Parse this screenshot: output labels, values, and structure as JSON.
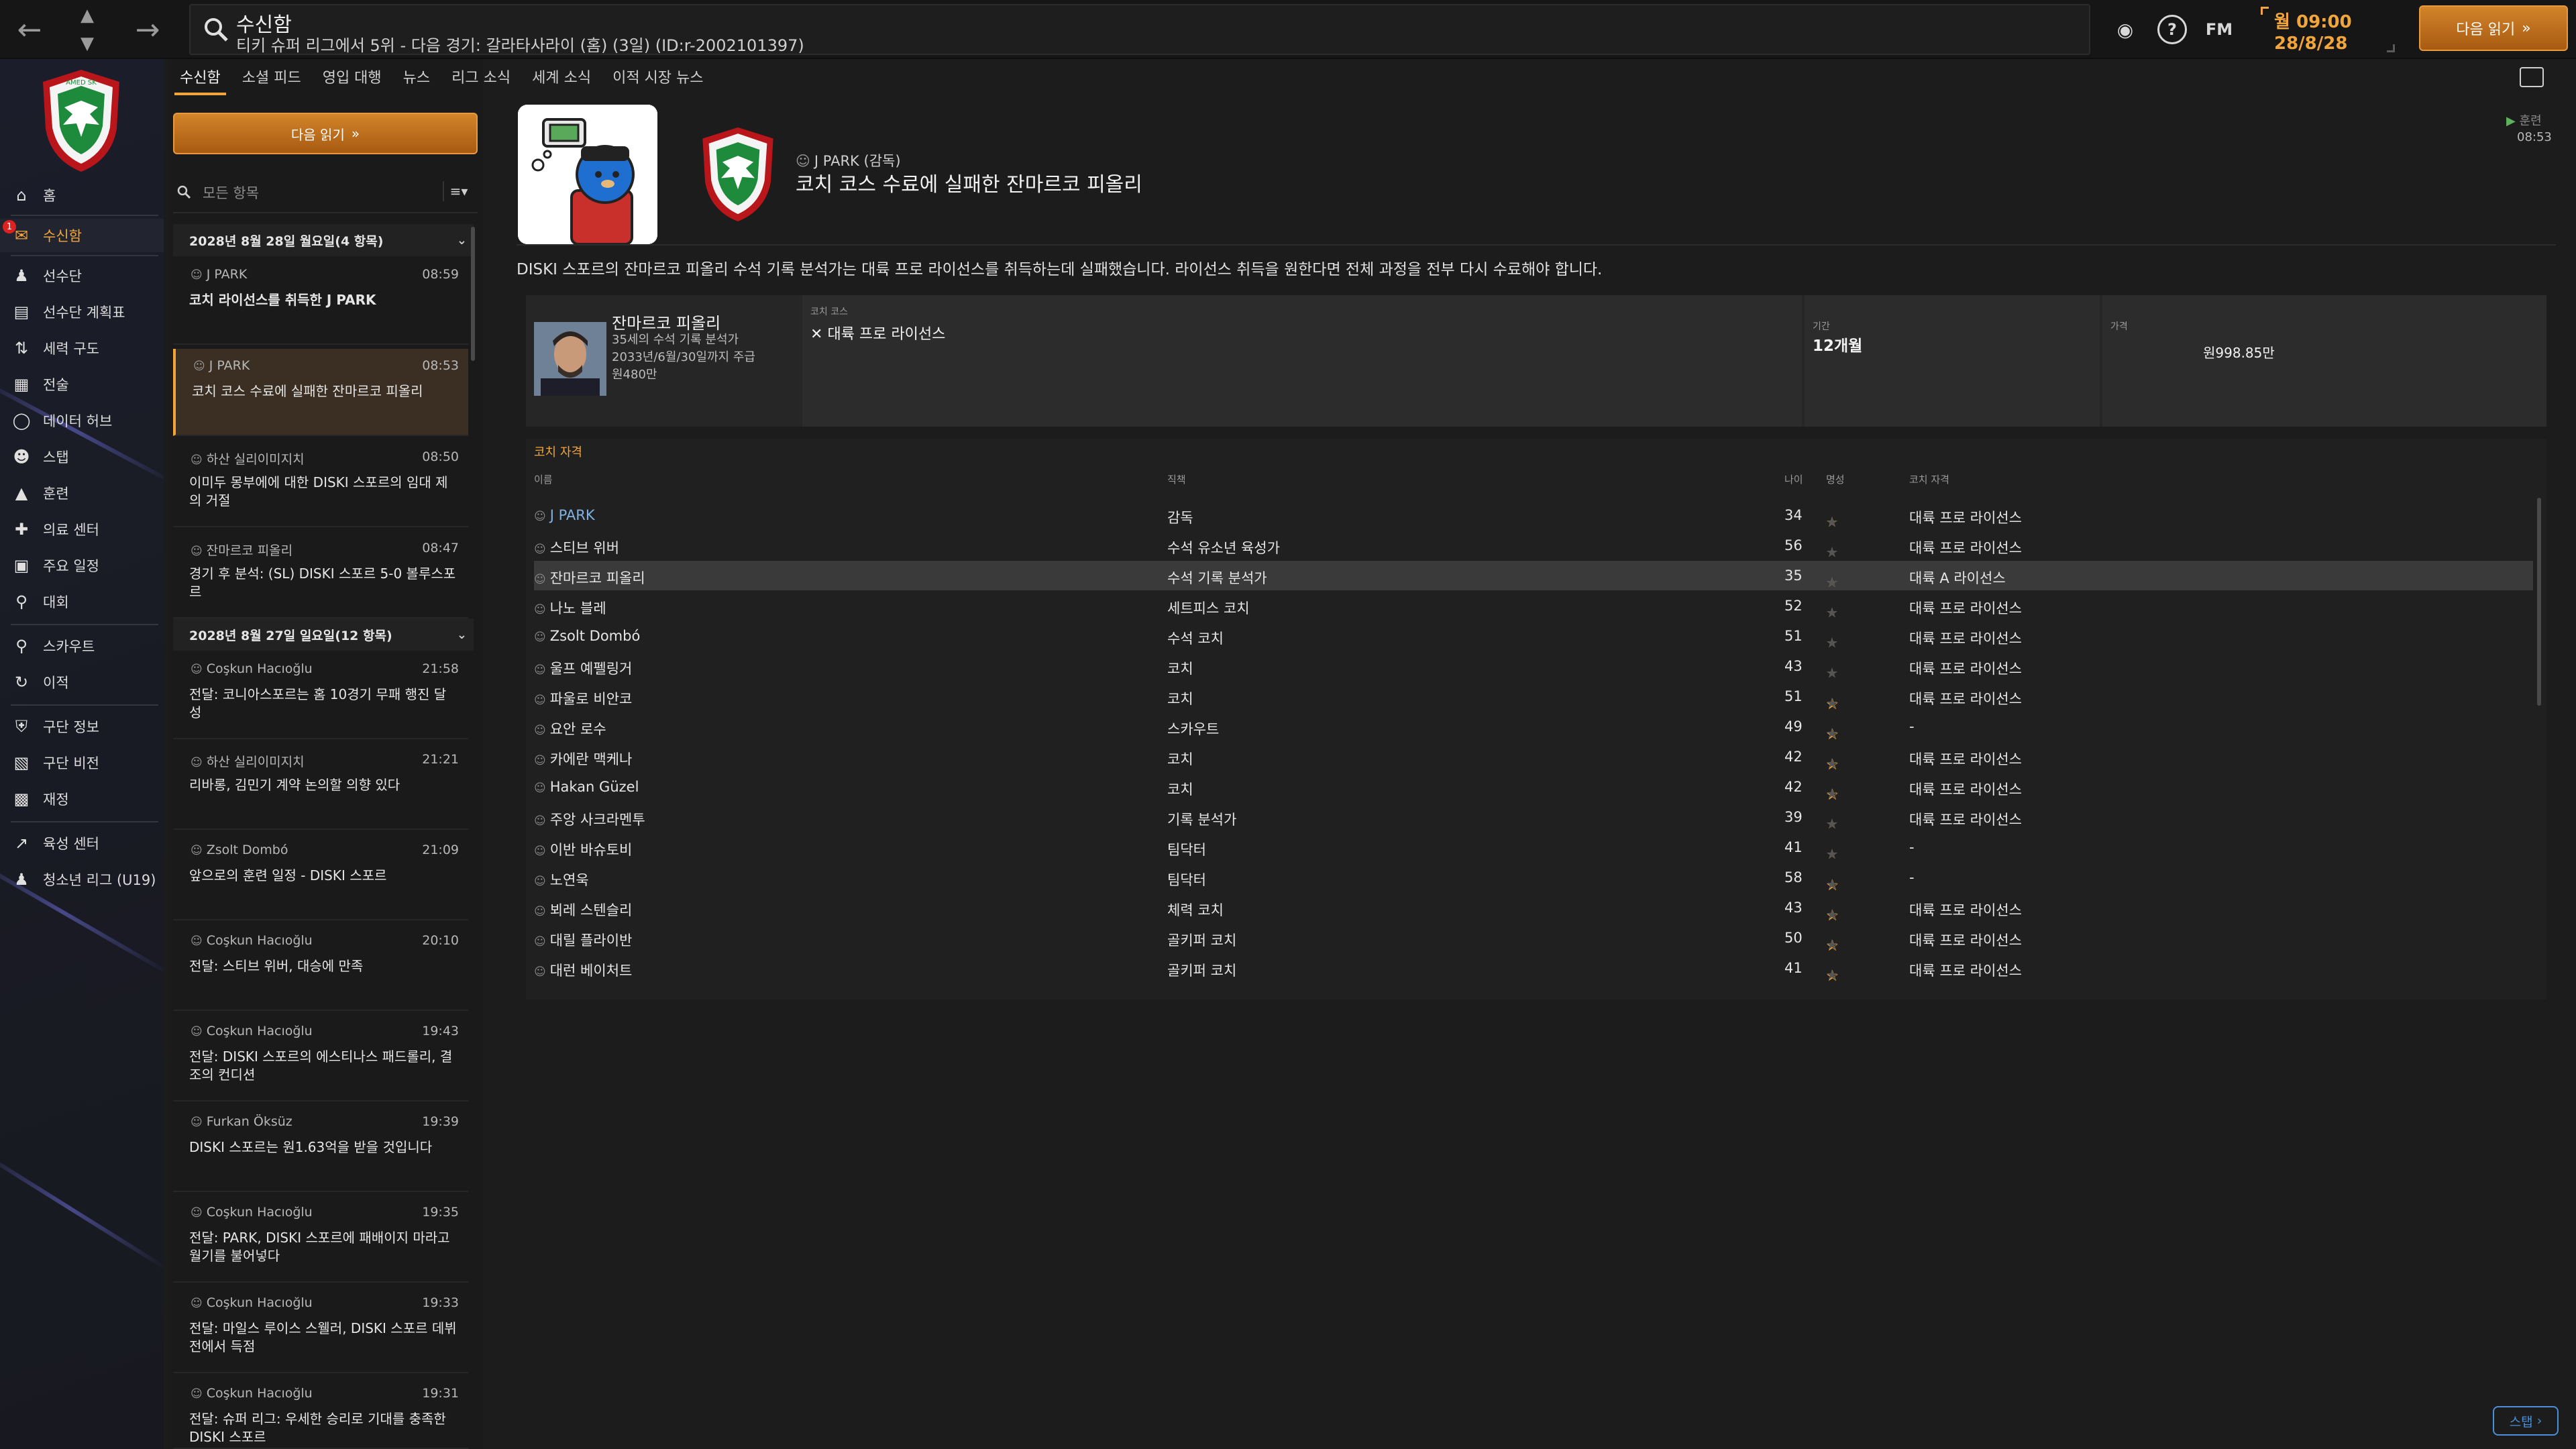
{
  "header": {
    "title": "수신함",
    "subtitle": "티키 슈퍼 리그에서 5위 - 다음 경기: 갈라타사라이 (홈) (3일) (ID:r-2002101397)",
    "fm_label": "FM",
    "day_time": "월 09:00",
    "date": "28/8/28",
    "continue_label": "다음 읽기"
  },
  "sidebar": {
    "badge": "1",
    "items": [
      {
        "label": "홈",
        "icon": "home-icon"
      },
      {
        "label": "수신함",
        "icon": "inbox-icon"
      },
      {
        "label": "선수단",
        "icon": "squad-icon"
      },
      {
        "label": "선수단 계획표",
        "icon": "plan-icon"
      },
      {
        "label": "세력 구도",
        "icon": "dynamics-icon"
      },
      {
        "label": "전술",
        "icon": "tactics-icon"
      },
      {
        "label": "데이터 허브",
        "icon": "data-hub-icon"
      },
      {
        "label": "스탭",
        "icon": "staff-icon"
      },
      {
        "label": "훈련",
        "icon": "training-icon"
      },
      {
        "label": "의료 센터",
        "icon": "medical-icon"
      },
      {
        "label": "주요 일정",
        "icon": "calendar-icon"
      },
      {
        "label": "대회",
        "icon": "trophy-icon"
      },
      {
        "label": "스카우트",
        "icon": "scout-icon"
      },
      {
        "label": "이적",
        "icon": "transfer-icon"
      },
      {
        "label": "구단 정보",
        "icon": "club-info-icon"
      },
      {
        "label": "구단 비전",
        "icon": "club-vision-icon"
      },
      {
        "label": "재정",
        "icon": "finance-icon"
      },
      {
        "label": "육성 센터",
        "icon": "development-icon"
      },
      {
        "label": "청소년 리그 (U19)",
        "icon": "youth-icon"
      }
    ]
  },
  "tabs": [
    "수신함",
    "소셜 피드",
    "영입 대행",
    "뉴스",
    "리그 소식",
    "세계 소식",
    "이적 시장 뉴스"
  ],
  "left": {
    "read_button": "다음 읽기",
    "filter_placeholder": "모든 항목",
    "groups": [
      {
        "label": "2028년 8월 28일 월요일(4 항목)"
      },
      {
        "label": "2028년 8월 27일 일요일(12 항목)"
      }
    ],
    "messages": [
      {
        "sender": "J PARK",
        "time": "08:59",
        "subject": "코치 라이선스를 취득한 J PARK"
      },
      {
        "sender": "J PARK",
        "time": "08:53",
        "subject": "코치 코스 수료에 실패한 잔마르코 피올리"
      },
      {
        "sender": "하산 실리이미지치",
        "time": "08:50",
        "subject": "이미두 몽부에에 대한 DISKI 스포르의 임대 제의 거절"
      },
      {
        "sender": "잔마르코 피올리",
        "time": "08:47",
        "subject": "경기 후 분석: (SL) DISKI 스포르 5-0 볼루스포르"
      },
      {
        "sender": "Coşkun Hacıoğlu",
        "time": "21:58",
        "subject": "전달: 코니아스포르는 홈 10경기 무패 행진 달성"
      },
      {
        "sender": "하산 실리이미지치",
        "time": "21:21",
        "subject": "리바롱, 김민기 계약 논의할 의향 있다"
      },
      {
        "sender": "Zsolt Dombó",
        "time": "21:09",
        "subject": "앞으로의 훈련 일정 - DISKI 스포르"
      },
      {
        "sender": "Coşkun Hacıoğlu",
        "time": "20:10",
        "subject": "전달: 스티브 위버, 대승에 만족"
      },
      {
        "sender": "Coşkun Hacıoğlu",
        "time": "19:43",
        "subject": "전달: DISKI 스포르의 에스티나스 패드롤리, 결조의 컨디션"
      },
      {
        "sender": "Furkan Öksüz",
        "time": "19:39",
        "subject": "DISKI 스포르는 원1.63억을 받을 것입니다"
      },
      {
        "sender": "Coşkun Hacıoğlu",
        "time": "19:35",
        "subject": "전달: PARK, DISKI 스포르에 패배이지 마라고 월기를 불어넣다"
      },
      {
        "sender": "Coşkun Hacıoğlu",
        "time": "19:33",
        "subject": "전달: 마일스 루이스 스웰러, DISKI 스포르 데뷔전에서 득점"
      },
      {
        "sender": "Coşkun Hacıoğlu",
        "time": "19:31",
        "subject": "전달: 슈퍼 리그: 우세한 승리로 기대를 충족한 DISKI 스포르"
      }
    ]
  },
  "main": {
    "from": "J PARK (감독)",
    "title": "코치 코스 수료에 실패한 잔마르코 피올리",
    "tag": "훈련",
    "time": "08:53",
    "body": "DISKI 스포르의 잔마르코 피올리 수석 기록 분석가는 대륙 프로 라이선스를 취득하는데 실패했습니다. 라이선스 취득을 원한다면 전체 과정을 전부 다시 수료해야 합니다.",
    "card": {
      "name": "잔마르코 피올리",
      "line1": "35세의 수석 기록 분석가",
      "line2": "2033년/6월/30일까지 주급",
      "line3": "원480만",
      "course_caption": "코치 코스",
      "course_value": "대륙 프로 라이선스",
      "duration_caption": "기간",
      "duration_value": "12개월",
      "cost_caption": "가격",
      "cost_value": "원998.85만"
    },
    "table": {
      "title": "코치 자격",
      "headers": {
        "name": "이름",
        "role": "직책",
        "age": "나이",
        "rep": "명성",
        "license": "코치 자격"
      },
      "rows": [
        {
          "name": "J PARK",
          "role": "감독",
          "age": "34",
          "stars": 4,
          "license": "대륙 프로 라이선스"
        },
        {
          "name": "스티브 위버",
          "role": "수석 유소년 육성가",
          "age": "56",
          "stars": 2,
          "license": "대륙 프로 라이선스"
        },
        {
          "name": "잔마르코 피올리",
          "role": "수석 기록 분석가",
          "age": "35",
          "stars": 3,
          "license": "대륙 A 라이선스"
        },
        {
          "name": "나노 블레",
          "role": "세트피스 코치",
          "age": "52",
          "stars": 2,
          "license": "대륙 프로 라이선스"
        },
        {
          "name": "Zsolt Dombó",
          "role": "수석 코치",
          "age": "51",
          "stars": 2,
          "license": "대륙 프로 라이선스"
        },
        {
          "name": "울프 예펠링거",
          "role": "코치",
          "age": "43",
          "stars": 2,
          "license": "대륙 프로 라이선스"
        },
        {
          "name": "파울로 비안코",
          "role": "코치",
          "age": "51",
          "stars": 2.5,
          "license": "대륙 프로 라이선스"
        },
        {
          "name": "요안 로수",
          "role": "스카우트",
          "age": "49",
          "stars": 2.5,
          "license": "-"
        },
        {
          "name": "카에란 맥케나",
          "role": "코치",
          "age": "42",
          "stars": 2.5,
          "license": "대륙 프로 라이선스"
        },
        {
          "name": "Hakan Güzel",
          "role": "코치",
          "age": "42",
          "stars": 2.5,
          "license": "대륙 프로 라이선스"
        },
        {
          "name": "주앙 사크라멘투",
          "role": "기록 분석가",
          "age": "39",
          "stars": 3,
          "license": "대륙 프로 라이선스"
        },
        {
          "name": "이반 바슈토비",
          "role": "팀닥터",
          "age": "41",
          "stars": 3,
          "license": "-"
        },
        {
          "name": "노연욱",
          "role": "팀닥터",
          "age": "58",
          "stars": 1.5,
          "license": "-"
        },
        {
          "name": "뵈레 스텐슬리",
          "role": "체력 코치",
          "age": "43",
          "stars": 1.5,
          "license": "대륙 프로 라이선스"
        },
        {
          "name": "대릴 플라이반",
          "role": "골키퍼 코치",
          "age": "50",
          "stars": 2.5,
          "license": "대륙 프로 라이선스"
        },
        {
          "name": "대런 베이처트",
          "role": "골키퍼 코치",
          "age": "41",
          "stars": 2.5,
          "license": "대륙 프로 라이선스"
        }
      ]
    }
  },
  "bottom_button": "스탭",
  "colors": {
    "accent": "#f2a53a",
    "link": "#7fb2e0",
    "bg": "#1c1c1c"
  }
}
